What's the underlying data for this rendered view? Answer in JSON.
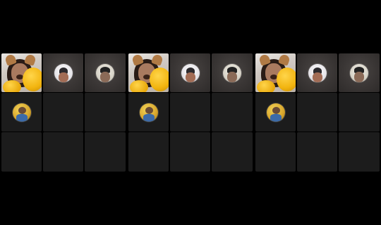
{
  "screen": {
    "background": "#000000",
    "tile_color": "#1c1c1c"
  },
  "grids": [
    {
      "tiles": [
        {
          "kind": "video-feed",
          "icon": "participant-video"
        },
        {
          "kind": "avatar",
          "icon": "participant-avatar-1"
        },
        {
          "kind": "avatar",
          "icon": "participant-avatar-2"
        },
        {
          "kind": "avatar",
          "icon": "participant-avatar-3"
        },
        {
          "kind": "empty"
        },
        {
          "kind": "empty"
        },
        {
          "kind": "empty"
        },
        {
          "kind": "empty"
        },
        {
          "kind": "empty"
        }
      ]
    },
    {
      "tiles": [
        {
          "kind": "video-feed",
          "icon": "participant-video"
        },
        {
          "kind": "avatar",
          "icon": "participant-avatar-1"
        },
        {
          "kind": "avatar",
          "icon": "participant-avatar-2"
        },
        {
          "kind": "avatar",
          "icon": "participant-avatar-3"
        },
        {
          "kind": "empty"
        },
        {
          "kind": "empty"
        },
        {
          "kind": "empty"
        },
        {
          "kind": "empty"
        },
        {
          "kind": "empty"
        }
      ]
    },
    {
      "tiles": [
        {
          "kind": "video-feed",
          "icon": "participant-video"
        },
        {
          "kind": "avatar",
          "icon": "participant-avatar-1"
        },
        {
          "kind": "avatar",
          "icon": "participant-avatar-2"
        },
        {
          "kind": "avatar",
          "icon": "participant-avatar-3"
        },
        {
          "kind": "empty"
        },
        {
          "kind": "empty"
        },
        {
          "kind": "empty"
        },
        {
          "kind": "empty"
        },
        {
          "kind": "empty"
        }
      ]
    }
  ]
}
